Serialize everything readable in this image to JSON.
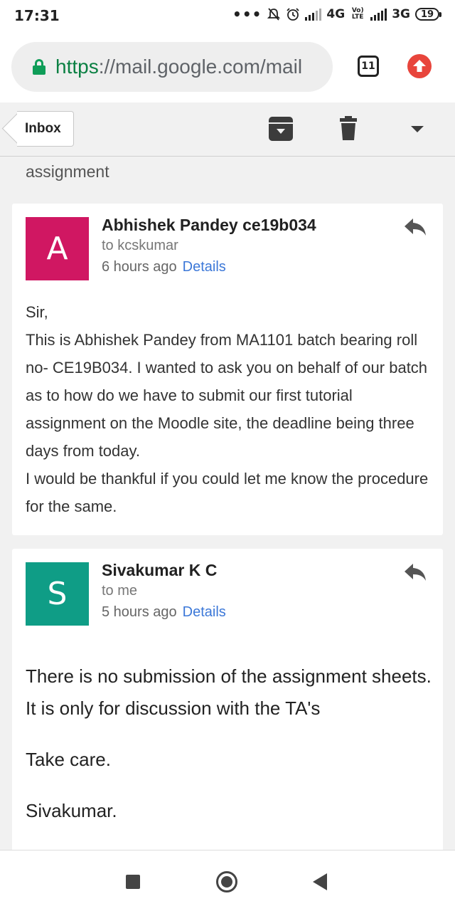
{
  "status_bar": {
    "time": "17:31",
    "dots": "•••",
    "network_1": "4G",
    "volte": "Vo) LTE",
    "network_2": "3G",
    "battery": "19",
    "icons": [
      "more-dots-icon",
      "mute-icon",
      "alarm-icon",
      "signal-icon",
      "signal-icon",
      "battery-icon"
    ]
  },
  "browser": {
    "url_scheme": "https",
    "url_rest": "://mail.google.com/mail",
    "tab_count": "11",
    "icons": [
      "lock-icon",
      "tab-switcher-icon",
      "update-icon"
    ]
  },
  "toolbar": {
    "back_label": "Inbox",
    "icons": [
      "archive-icon",
      "delete-icon",
      "more-dropdown-icon"
    ]
  },
  "thread": {
    "subject": "assignment",
    "messages": [
      {
        "avatar_letter": "A",
        "avatar_color": "#d01762",
        "sender": "Abhishek Pandey ce19b034",
        "recipient": "to kcskumar",
        "time": "6 hours ago",
        "details_label": "Details",
        "body": [
          "Sir,",
          "This is Abhishek Pandey from MA1101 batch bearing roll no- CE19B034. I wanted to ask you on behalf of our batch as to how do we have to submit our first tutorial assignment on the Moodle site, the deadline being three days from today.",
          "I would be thankful if you could let me know the procedure for the same."
        ]
      },
      {
        "avatar_letter": "S",
        "avatar_color": "#0f9d86",
        "sender": "Sivakumar K C",
        "recipient": "to me",
        "time": "5 hours ago",
        "details_label": "Details",
        "body": [
          "There is no submission of the assignment sheets. It is only for discussion with the TA's",
          "Take care.",
          "Sivakumar."
        ]
      }
    ]
  },
  "colors": {
    "accent_link": "#3c78d8",
    "secure_green": "#0f9d58",
    "update_red": "#e8453c"
  }
}
